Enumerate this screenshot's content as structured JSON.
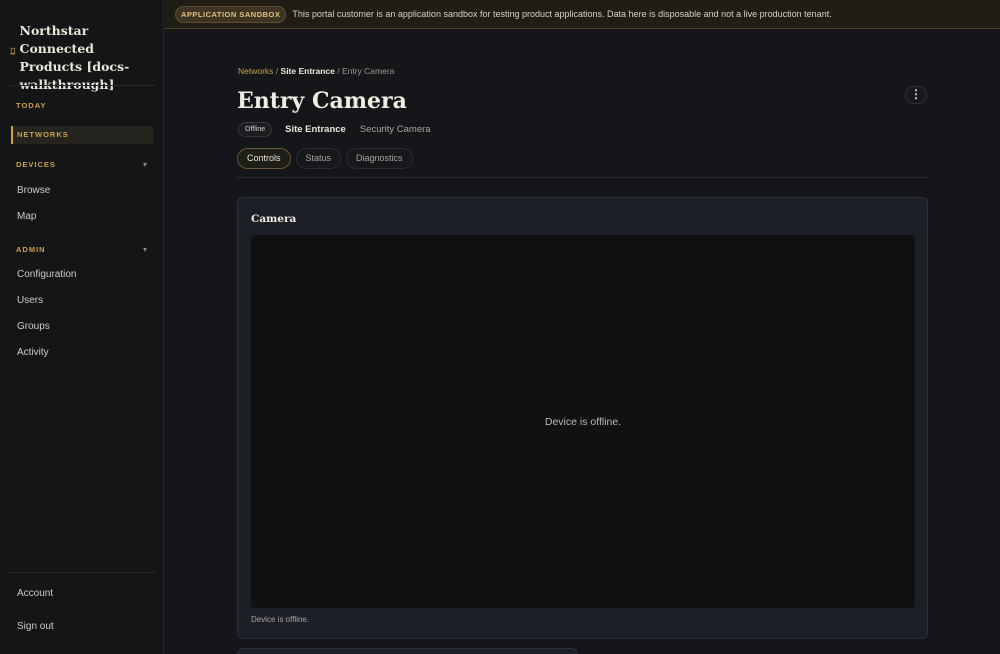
{
  "sidebar": {
    "brand": "Northstar Connected Products [docs-walkthrough]",
    "sections": {
      "today": "TODAY",
      "networks": "NETWORKS",
      "devices": "DEVICES",
      "admin": "ADMIN"
    },
    "devices_items": [
      "Browse",
      "Map"
    ],
    "admin_items": [
      "Configuration",
      "Users",
      "Groups",
      "Activity"
    ],
    "footer_items": [
      "Account",
      "Sign out"
    ],
    "caret": "▾"
  },
  "banner": {
    "badge": "APPLICATION SANDBOX",
    "text": "This portal customer is an application sandbox for testing product applications. Data here is disposable and not a live production tenant."
  },
  "breadcrumb": {
    "root": "Networks",
    "sep": " / ",
    "parent": "Site Entrance",
    "current": "Entry Camera"
  },
  "device": {
    "title": "Entry Camera",
    "status": "Offline",
    "location": "Site Entrance",
    "type": "Security Camera",
    "more_glyph": "⋮"
  },
  "tabs": [
    "Controls",
    "Status",
    "Diagnostics"
  ],
  "card": {
    "title": "Camera",
    "video_message": "Device is offline.",
    "caption": "Device is offline."
  },
  "colors": {
    "accent": "#c9a24a",
    "background": "#141619",
    "card": "#1c2026"
  }
}
